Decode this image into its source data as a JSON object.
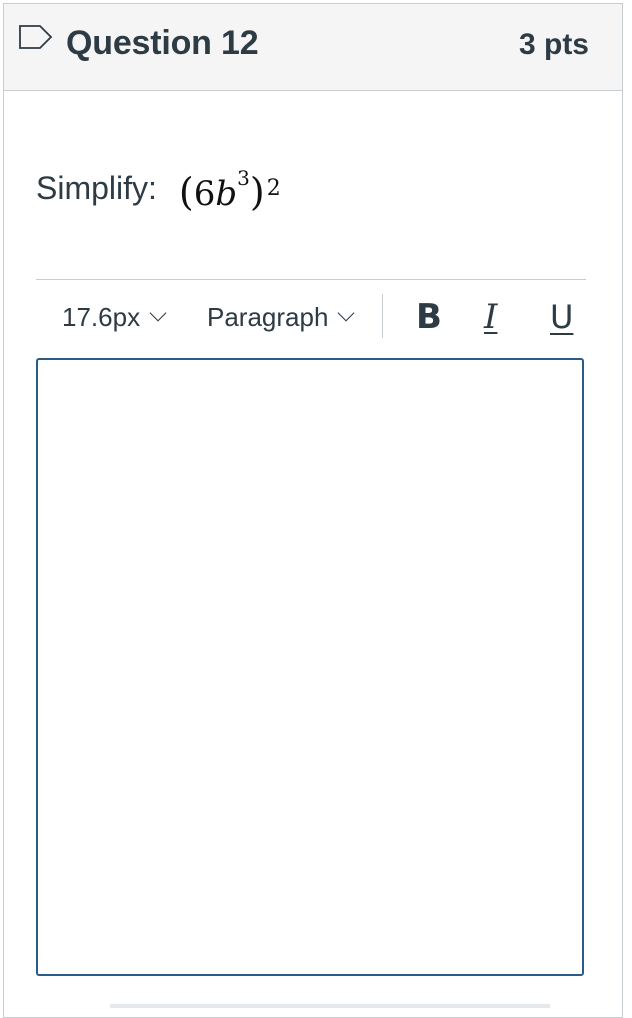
{
  "question": {
    "title": "Question 12",
    "points": "3 pts",
    "prompt_label": "Simplify:",
    "expression": {
      "open_paren": "(",
      "coefficient": "6",
      "variable": "b",
      "inner_exponent": "3",
      "close_paren": ")",
      "outer_exponent": "2"
    }
  },
  "toolbar": {
    "font_size": "17.6px",
    "block_format": "Paragraph",
    "bold_label": "B",
    "italic_label": "I",
    "underline_label": "U"
  },
  "editor": {
    "value": ""
  },
  "colors": {
    "header_bg": "#f5f5f5",
    "border": "#c7cdd1",
    "text": "#2d3b45",
    "editor_border": "#2b5c88"
  },
  "icons": {
    "flag": "bookmark-flag-icon",
    "dropdown": "chevron-down-icon"
  }
}
